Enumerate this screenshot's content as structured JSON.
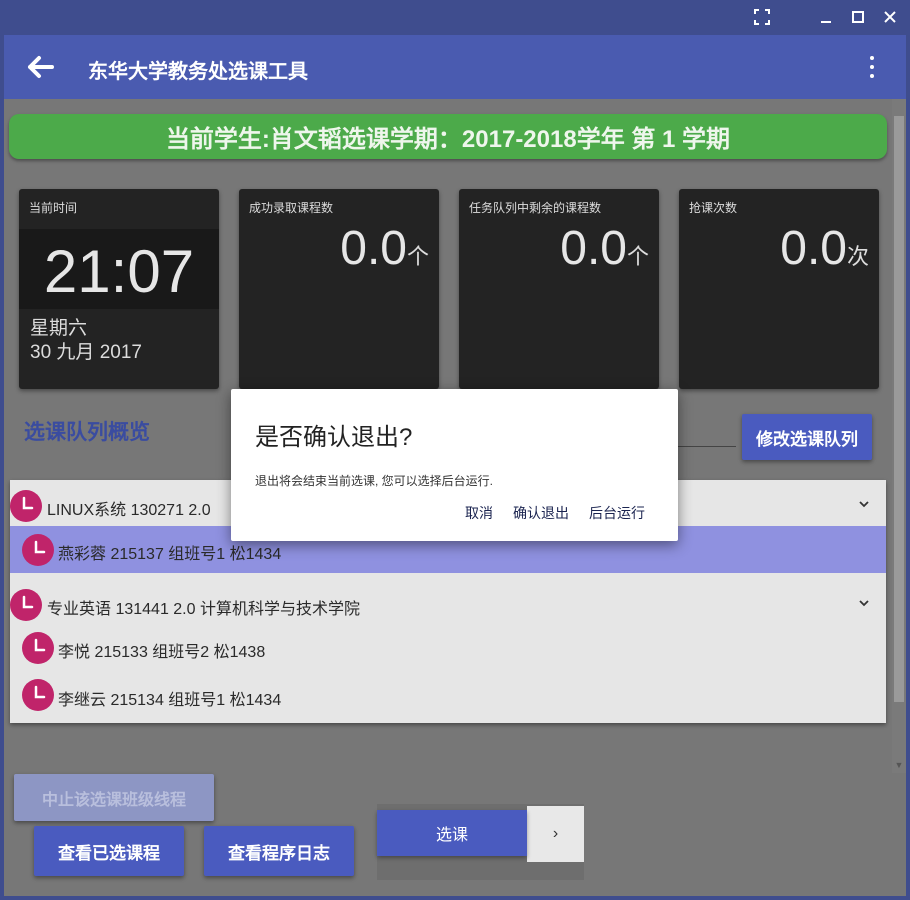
{
  "window": {
    "controls": [
      "fullscreen-icon",
      "minimize-icon",
      "maximize-icon",
      "close-icon"
    ]
  },
  "appbar": {
    "title": "东华大学教务处选课工具",
    "back_icon": "arrow-left-icon",
    "menu_icon": "more-vertical-icon"
  },
  "banner": {
    "text": "当前学生:肖文韬选课学期：2017-2018学年 第 1 学期"
  },
  "cards": {
    "time": {
      "label": "当前时间",
      "value": "21:07",
      "weekday": "星期六",
      "date": "30 九月 2017"
    },
    "success": {
      "label": "成功录取课程数",
      "value": "0.0",
      "unit": "个"
    },
    "remaining": {
      "label": "任务队列中剩余的课程数",
      "value": "0.0",
      "unit": "个"
    },
    "attempts": {
      "label": "抢课次数",
      "value": "0.0",
      "unit": "次"
    }
  },
  "queue": {
    "title": "选课队列概览",
    "edit_button": "修改选课队列",
    "groups": [
      {
        "title": "LINUX系统  130271  2.0",
        "classes": [
          {
            "text": "燕彩蓉  215137 组班号1  松1434"
          }
        ]
      },
      {
        "title": "专业英语  131441  2.0  计算机科学与技术学院",
        "classes": [
          {
            "text": "李悦  215133 组班号2  松1438"
          },
          {
            "text": "李继云  215134 组班号1  松1434"
          }
        ]
      }
    ]
  },
  "dialog": {
    "title": "是否确认退出?",
    "message": "退出将会结束当前选课, 您可以选择后台运行.",
    "cancel": "取消",
    "confirm": "确认退出",
    "background": "后台运行"
  },
  "bottom": {
    "stop_thread": "中止该选课班级线程",
    "view_selected": "查看已选课程",
    "view_log": "查看程序日志",
    "start": "选课",
    "next": "›"
  },
  "colors": {
    "primary": "#4a5bbf",
    "banner": "#4caa4a",
    "highlight": "#8f91e0",
    "clock": "#c0246a"
  }
}
